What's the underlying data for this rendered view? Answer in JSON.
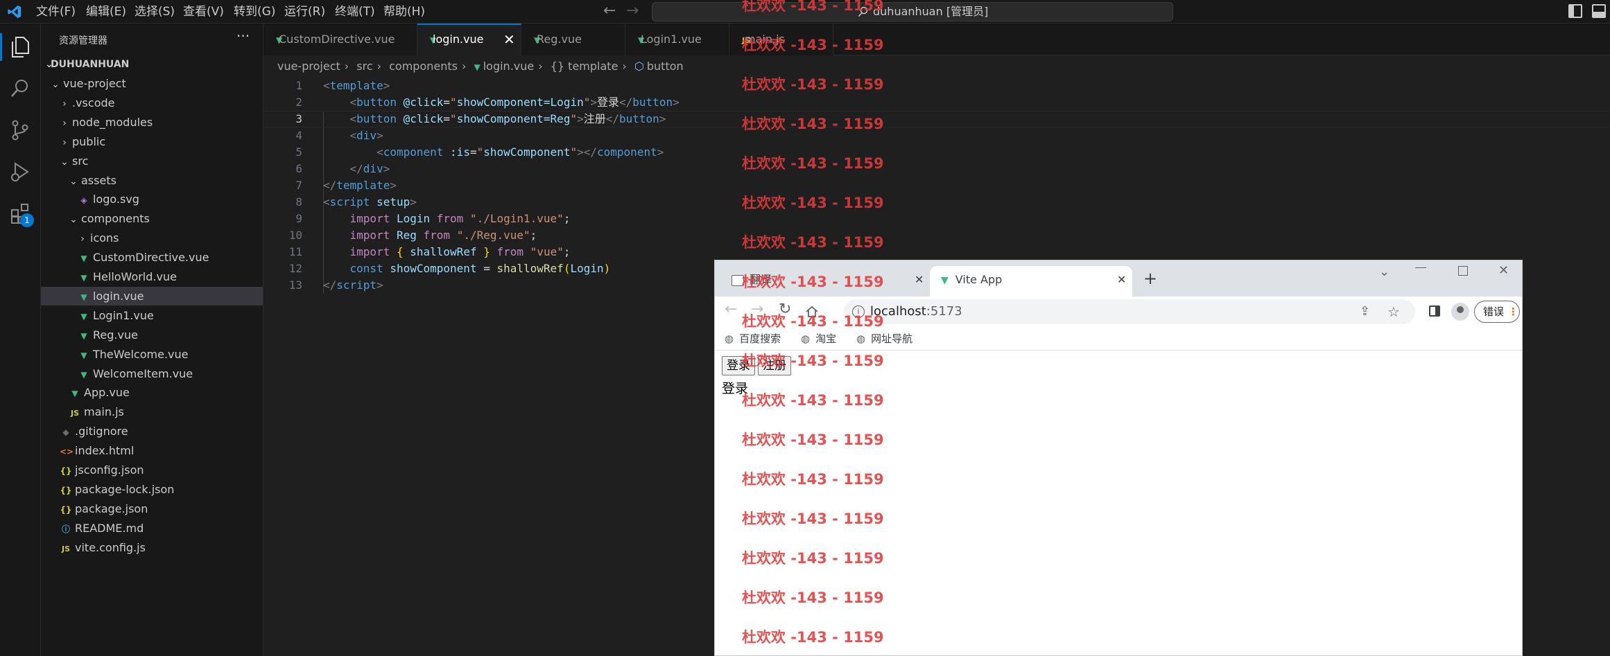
{
  "menu": [
    "文件(F)",
    "编辑(E)",
    "选择(S)",
    "查看(V)",
    "转到(G)",
    "运行(R)",
    "终端(T)",
    "帮助(H)"
  ],
  "command_center": "duhuanhuan [管理员]",
  "sidebar": {
    "title": "资源管理器",
    "workspace": "DUHUANHUAN",
    "tree": [
      {
        "label": "vue-project",
        "type": "folder-open",
        "depth": 1
      },
      {
        "label": ".vscode",
        "type": "folder",
        "depth": 2
      },
      {
        "label": "node_modules",
        "type": "folder",
        "depth": 2
      },
      {
        "label": "public",
        "type": "folder",
        "depth": 2
      },
      {
        "label": "src",
        "type": "folder-open",
        "depth": 2
      },
      {
        "label": "assets",
        "type": "folder-open",
        "depth": 3
      },
      {
        "label": "logo.svg",
        "type": "svg",
        "depth": 4
      },
      {
        "label": "components",
        "type": "folder-open",
        "depth": 3
      },
      {
        "label": "icons",
        "type": "folder",
        "depth": 4
      },
      {
        "label": "CustomDirective.vue",
        "type": "vue",
        "depth": 4
      },
      {
        "label": "HelloWorld.vue",
        "type": "vue",
        "depth": 4
      },
      {
        "label": "login.vue",
        "type": "vue",
        "depth": 4,
        "selected": true
      },
      {
        "label": "Login1.vue",
        "type": "vue",
        "depth": 4
      },
      {
        "label": "Reg.vue",
        "type": "vue",
        "depth": 4
      },
      {
        "label": "TheWelcome.vue",
        "type": "vue",
        "depth": 4
      },
      {
        "label": "WelcomeItem.vue",
        "type": "vue",
        "depth": 4
      },
      {
        "label": "App.vue",
        "type": "vue",
        "depth": 3
      },
      {
        "label": "main.js",
        "type": "js",
        "depth": 3
      },
      {
        "label": ".gitignore",
        "type": "git",
        "depth": 2
      },
      {
        "label": "index.html",
        "type": "html",
        "depth": 2
      },
      {
        "label": "jsconfig.json",
        "type": "json",
        "depth": 2
      },
      {
        "label": "package-lock.json",
        "type": "json",
        "depth": 2
      },
      {
        "label": "package.json",
        "type": "json",
        "depth": 2
      },
      {
        "label": "README.md",
        "type": "info",
        "depth": 2
      },
      {
        "label": "vite.config.js",
        "type": "js",
        "depth": 2
      }
    ]
  },
  "tabs": [
    {
      "label": "CustomDirective.vue",
      "icon": "vue"
    },
    {
      "label": "login.vue",
      "icon": "vue",
      "active": true
    },
    {
      "label": "Reg.vue",
      "icon": "vue"
    },
    {
      "label": "Login1.vue",
      "icon": "vue"
    },
    {
      "label": "main.js",
      "icon": "js"
    }
  ],
  "breadcrumbs": [
    "vue-project",
    "src",
    "components",
    "login.vue",
    "{} template",
    "button"
  ],
  "code": {
    "current_line": 3,
    "line_numbers": [
      "1",
      "2",
      "3",
      "4",
      "5",
      "6",
      "7",
      "8",
      "9",
      "10",
      "11",
      "12",
      "13"
    ],
    "l1": [
      "<",
      "template",
      ">"
    ],
    "l2": [
      "<",
      "button",
      " ",
      "@click",
      "=",
      "\"",
      "showComponent=Login",
      "\"",
      ">",
      "登录",
      "</",
      "button",
      ">"
    ],
    "l3": [
      "<",
      "button",
      " ",
      "@click",
      "=",
      "\"",
      "showComponent=Reg",
      "\"",
      ">",
      "注册",
      "</",
      "button",
      ">"
    ],
    "l4": [
      "<",
      "div",
      ">"
    ],
    "l5": [
      "<",
      "component",
      " ",
      ":is",
      "=",
      "\"",
      "showComponent",
      "\"",
      "></",
      "component",
      ">"
    ],
    "l6": [
      "</",
      "div",
      ">"
    ],
    "l7": [
      "</",
      "template",
      ">"
    ],
    "l8": [
      "<",
      "script",
      " ",
      "setup",
      ">"
    ],
    "l9": [
      "import",
      " ",
      "Login",
      " ",
      "from",
      " ",
      "\"./Login1.vue\"",
      ";"
    ],
    "l10": [
      "import",
      " ",
      "Reg",
      " ",
      "from",
      " ",
      "\"./Reg.vue\"",
      ";"
    ],
    "l11": [
      "import",
      " ",
      "{",
      " ",
      "shallowRef",
      " ",
      "}",
      " ",
      "from",
      " ",
      "\"vue\"",
      ";"
    ],
    "l12": [
      "const",
      " ",
      "showComponent",
      " = ",
      "shallowRef",
      "(",
      "Login",
      ")"
    ],
    "l13": [
      "</",
      "script",
      ">"
    ]
  },
  "watermark": "杜欢欢 -143 - 1159",
  "browser": {
    "tabs": [
      {
        "label": "翻译",
        "active": false
      },
      {
        "label": "Vite App",
        "active": true
      }
    ],
    "new_tab": "+",
    "url_host": "localhost",
    "url_port": ":5173",
    "error_button": "错误",
    "bookmarks": [
      "百度搜索",
      "淘宝",
      "网址导航"
    ],
    "page": {
      "buttons": [
        "登录",
        "注册"
      ],
      "component_text": "登录"
    }
  },
  "colors": {
    "accent": "#0078d4",
    "vue_green": "#41b883",
    "watermark_red": "#e23b3b",
    "badge": "#0078d4"
  }
}
